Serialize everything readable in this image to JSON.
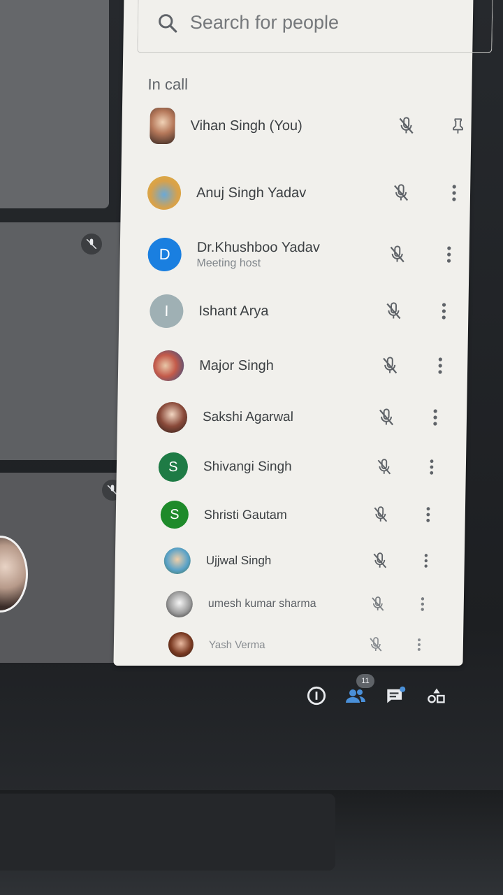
{
  "search": {
    "placeholder": "Search for people",
    "icon": "search-icon"
  },
  "section_label": "In call",
  "participants": [
    {
      "name": "Vihan Singh (You)",
      "subtitle": "",
      "avatar": "photo",
      "action_icon": "pin-icon"
    },
    {
      "name": "Anuj Singh Yadav",
      "subtitle": "",
      "avatar": "photo",
      "action_icon": "more-vert-icon"
    },
    {
      "name": "Dr.Khushboo Yadav",
      "subtitle": "Meeting host",
      "avatar_letter": "D",
      "action_icon": "more-vert-icon"
    },
    {
      "name": "Ishant Arya",
      "subtitle": "",
      "avatar_letter": "I",
      "action_icon": "more-vert-icon"
    },
    {
      "name": "Major Singh",
      "subtitle": "",
      "avatar": "photo",
      "action_icon": "more-vert-icon"
    },
    {
      "name": "Sakshi Agarwal",
      "subtitle": "",
      "avatar": "photo",
      "action_icon": "more-vert-icon"
    },
    {
      "name": "Shivangi Singh",
      "subtitle": "",
      "avatar_letter": "S",
      "action_icon": "more-vert-icon"
    },
    {
      "name": "Shristi Gautam",
      "subtitle": "",
      "avatar_letter": "S",
      "action_icon": "more-vert-icon"
    },
    {
      "name": "Ujjwal Singh",
      "subtitle": "",
      "avatar": "photo",
      "action_icon": "more-vert-icon"
    },
    {
      "name": "umesh kumar sharma",
      "subtitle": "",
      "avatar": "photo",
      "action_icon": "more-vert-icon"
    },
    {
      "name": "Yash Verma",
      "subtitle": "",
      "avatar": "photo",
      "action_icon": "more-vert-icon"
    }
  ],
  "toolbar": {
    "participants_count": "11",
    "icons": [
      "info-icon",
      "people-icon",
      "chat-icon",
      "activities-icon"
    ]
  },
  "colors": {
    "accent": "#1a73e8",
    "panel_bg": "#f1f0ec"
  }
}
